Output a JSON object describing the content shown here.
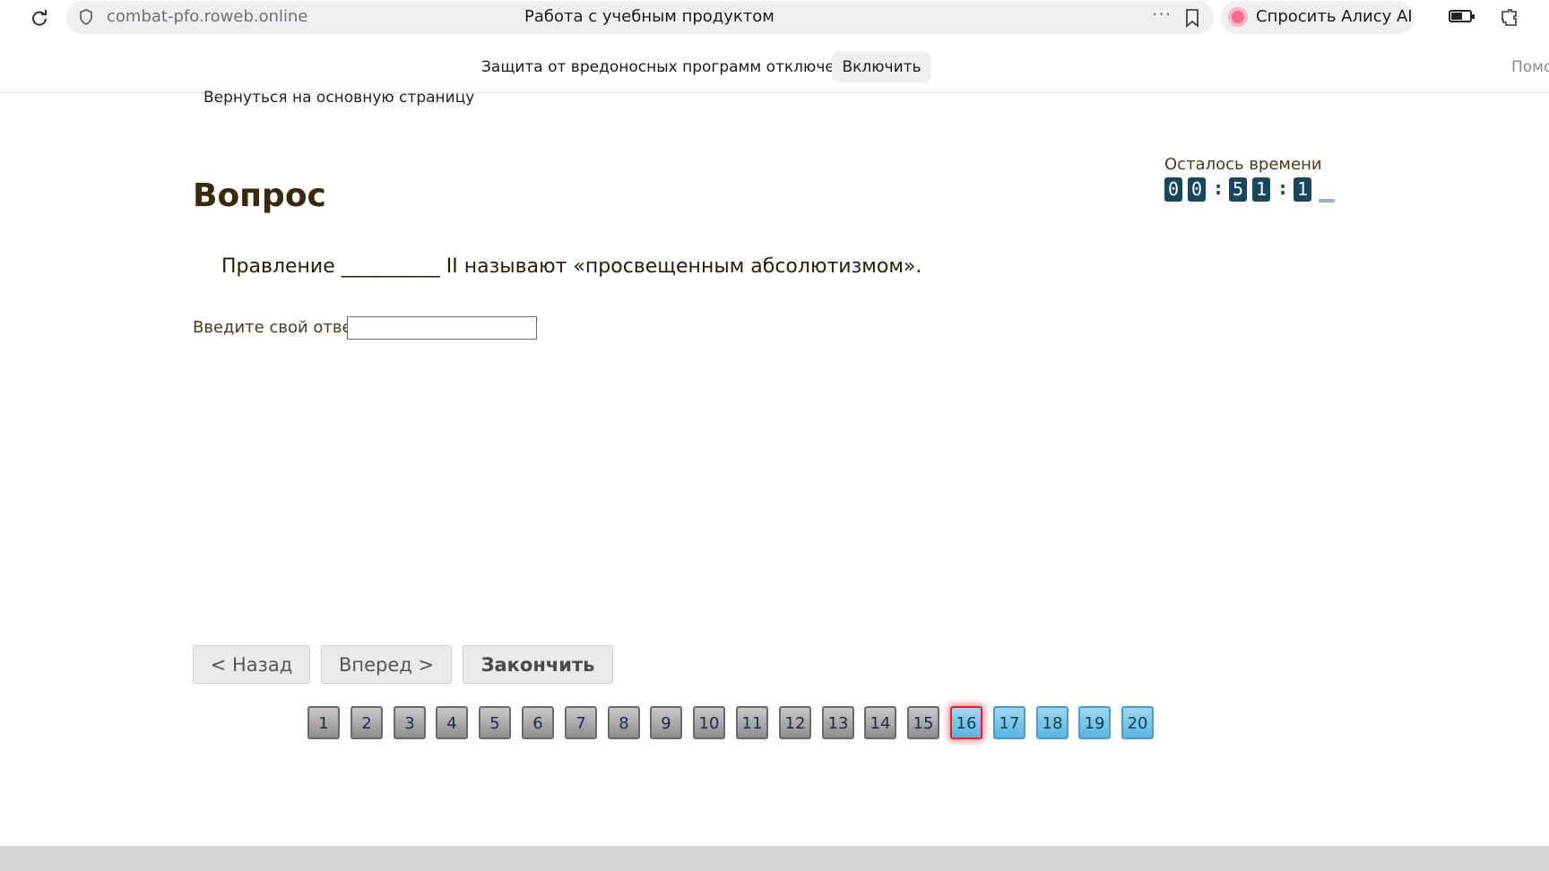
{
  "browser": {
    "url": "combat-pfo.roweb.online",
    "tab_title": "Работа с учебным продуктом",
    "alice_button": "Спросить Алису AI",
    "more_icon": "ellipsis-icon",
    "bookmark_icon": "bookmark-icon"
  },
  "infobar": {
    "message": "Защита от вредоносных программ отключена",
    "enable_label": "Включить",
    "help_cut": "Помо"
  },
  "page": {
    "back_link": "Вернуться на основную страницу",
    "heading": "Вопрос",
    "question": "Правление __________ II называют «просвещенным абсолютизмом».",
    "answer_label": "Введите свой ответ",
    "answer_value": ""
  },
  "timer": {
    "label": "Осталось времени",
    "digits": [
      "0",
      "0",
      "5",
      "1",
      "1"
    ]
  },
  "nav": {
    "back": "< Назад",
    "next": "Вперед >",
    "finish": "Закончить"
  },
  "pages": {
    "numbers": [
      "1",
      "2",
      "3",
      "4",
      "5",
      "6",
      "7",
      "8",
      "9",
      "10",
      "11",
      "12",
      "13",
      "14",
      "15",
      "16",
      "17",
      "18",
      "19",
      "20"
    ],
    "current": "16",
    "done_after_current": [
      "17",
      "18",
      "19",
      "20"
    ]
  }
}
